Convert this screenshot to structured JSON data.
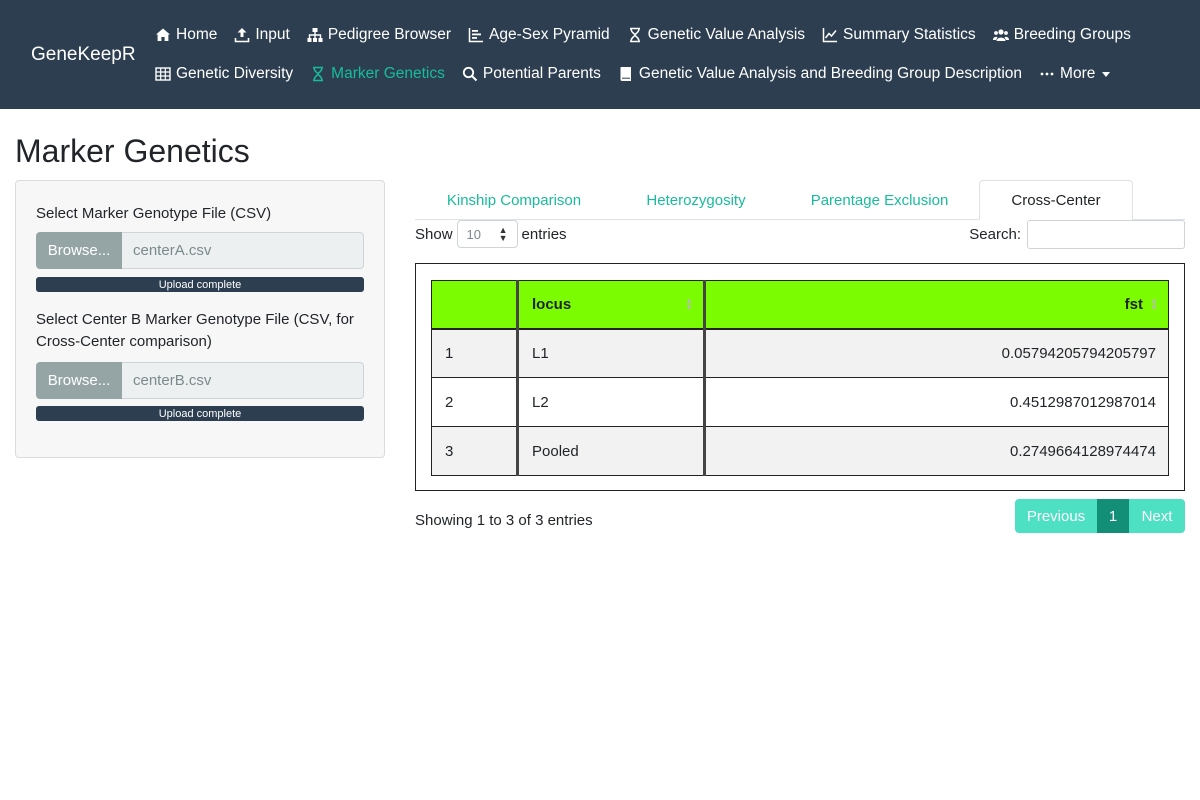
{
  "navbar": {
    "brand": "GeneKeepR",
    "row1": [
      {
        "label": "Home",
        "icon": "home-icon"
      },
      {
        "label": "Input",
        "icon": "upload-icon"
      },
      {
        "label": "Pedigree Browser",
        "icon": "sitemap-icon"
      },
      {
        "label": "Age-Sex Pyramid",
        "icon": "bar-chart-icon"
      },
      {
        "label": "Genetic Value Analysis",
        "icon": "hourglass-icon"
      },
      {
        "label": "Summary Statistics",
        "icon": "line-chart-icon"
      },
      {
        "label": "Breeding Groups",
        "icon": "users-icon"
      }
    ],
    "row2": [
      {
        "label": "Genetic Diversity",
        "icon": "table-icon"
      },
      {
        "label": "Marker Genetics",
        "icon": "hourglass-icon",
        "active": true
      },
      {
        "label": "Potential Parents",
        "icon": "search-icon"
      },
      {
        "label": "Genetic Value Analysis and Breeding Group Description",
        "icon": "book-icon"
      },
      {
        "label": "More",
        "icon": "ellipsis-icon"
      }
    ]
  },
  "page": {
    "title": "Marker Genetics"
  },
  "sidebar": {
    "file1": {
      "label": "Select Marker Genotype File (CSV)",
      "browse": "Browse...",
      "filename": "centerA.csv",
      "status": "Upload complete",
      "progress": 1.0
    },
    "file2": {
      "label_line1": "Select Center B Marker Genotype File (CSV, for",
      "label_line2": "Cross-Center comparison)",
      "browse": "Browse...",
      "filename": "centerB.csv",
      "status": "Upload complete",
      "progress": 1.0
    }
  },
  "tabs": [
    {
      "label": "Kinship Comparison"
    },
    {
      "label": "Heterozygosity"
    },
    {
      "label": "Parentage Exclusion"
    },
    {
      "label": "Cross-Center",
      "active": true
    }
  ],
  "table_controls": {
    "show": "Show",
    "length_value": "10",
    "entries": "entries",
    "search_label": "Search:"
  },
  "table": {
    "columns": [
      "",
      "locus",
      "fst"
    ],
    "rows": [
      [
        "1",
        "L1",
        "0.05794205794205797"
      ],
      [
        "2",
        "L2",
        "0.4512987012987014"
      ],
      [
        "3",
        "Pooled",
        "0.2749664128974474"
      ]
    ],
    "header_color": "#7cfc00"
  },
  "footer": {
    "info": "Showing 1 to 3 of 3 entries",
    "prev": "Previous",
    "page": "1",
    "next": "Next"
  },
  "colors": {
    "navbar": "#2c3e50",
    "accent": "#18bc9c",
    "progress": "#2c3e50"
  }
}
